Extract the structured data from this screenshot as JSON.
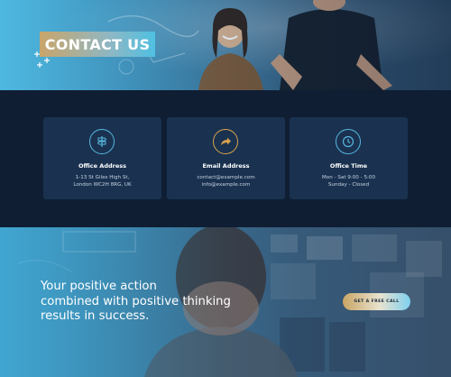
{
  "hero": {
    "title": "CONTACT US"
  },
  "contact": {
    "cards": [
      {
        "icon": "signpost-icon",
        "title": "Office Address",
        "lines": [
          "1-13 St Giles High St,",
          "London WC2H 8RG, UK"
        ],
        "accent": "#58b7e0"
      },
      {
        "icon": "share-arrow-icon",
        "title": "Email Address",
        "lines": [
          "contact@example.com",
          "info@example.com"
        ],
        "accent": "#d9a24c"
      },
      {
        "icon": "clock-icon",
        "title": "Office Time",
        "lines": [
          "Mon - Sat 9:00 - 5:00",
          "Sunday - Closed"
        ],
        "accent": "#58b7e0"
      }
    ]
  },
  "cta_section": {
    "quote_lines": [
      "Your positive action",
      "combined with positive thinking",
      "results in success."
    ],
    "button_label": "GET A FREE CALL"
  },
  "colors": {
    "page_bg": "#0f1e33",
    "card_bg": "#1a3250",
    "accent_blue": "#58b7e0",
    "accent_gold": "#d9a24c"
  }
}
